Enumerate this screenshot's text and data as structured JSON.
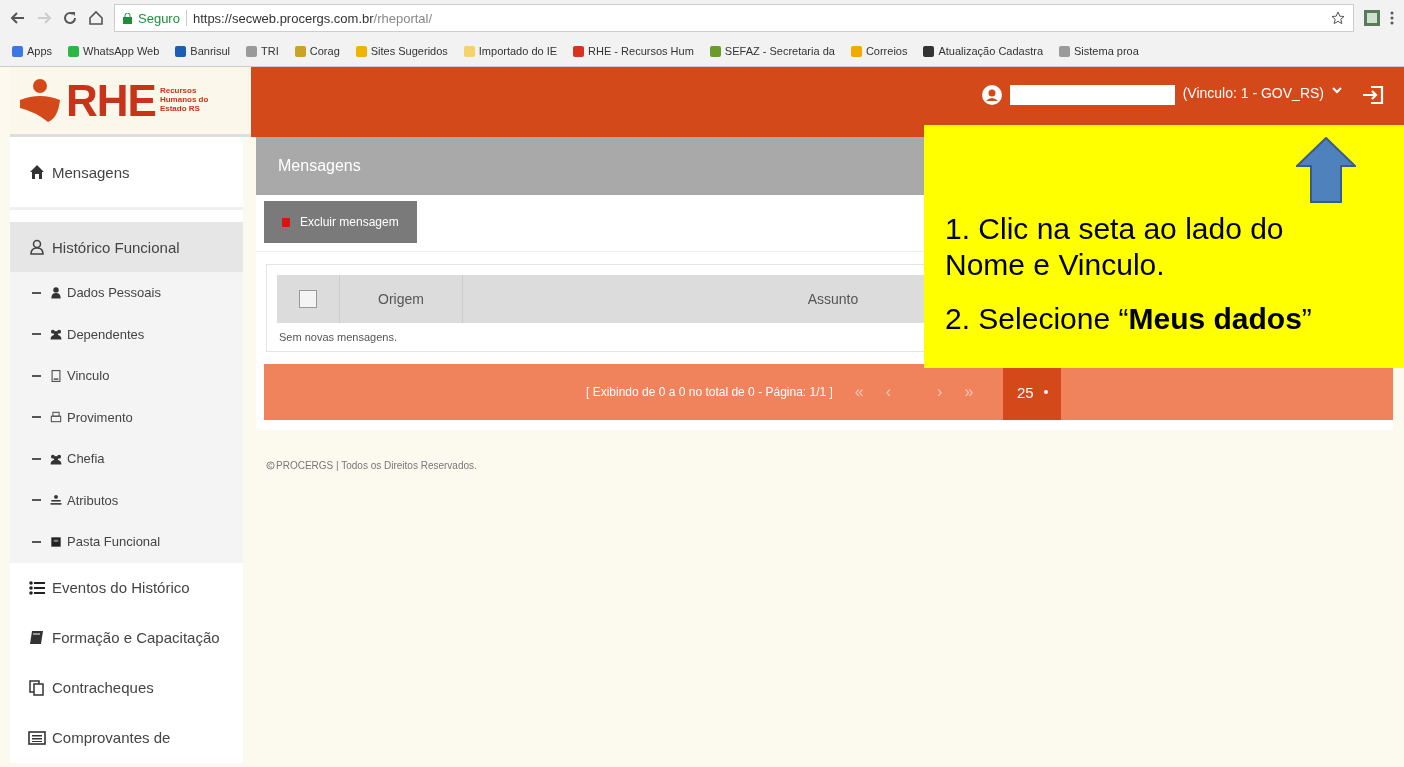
{
  "browser": {
    "secure_label": "Seguro",
    "url_host": "https://secweb.procergs.com.br",
    "url_path": "/rheportal/",
    "bookmarks": [
      {
        "label": "Apps",
        "color": "#3b78e7"
      },
      {
        "label": "WhatsApp Web",
        "color": "#2bb741"
      },
      {
        "label": "Banrisul",
        "color": "#1a5fb4"
      },
      {
        "label": "TRI",
        "color": "#9a9a9a"
      },
      {
        "label": "Corag",
        "color": "#c9a227"
      },
      {
        "label": "Sites Sugeridos",
        "color": "#f0b400"
      },
      {
        "label": "Importado do IE",
        "color": "#f5d36b"
      },
      {
        "label": "RHE - Recursos Hum",
        "color": "#d9321f"
      },
      {
        "label": "SEFAZ - Secretaria da",
        "color": "#6a9a2a"
      },
      {
        "label": "Correios",
        "color": "#f2a900"
      },
      {
        "label": "Atualização Cadastra",
        "color": "#333333"
      },
      {
        "label": "Sistema proa",
        "color": "#9a9a9a"
      }
    ]
  },
  "header": {
    "logo_text": "RHE",
    "logo_subtitle": "Recursos Humanos do Estado RS",
    "user_link": "(Vinculo: 1 - GOV_RS)"
  },
  "sidebar": {
    "items": [
      {
        "label": "Mensagens",
        "selected": false
      },
      {
        "label": "Histórico Funcional",
        "selected": true,
        "children": [
          {
            "label": "Dados Pessoais"
          },
          {
            "label": "Dependentes"
          },
          {
            "label": "Vinculo"
          },
          {
            "label": "Provimento"
          },
          {
            "label": "Chefia"
          },
          {
            "label": "Atributos"
          },
          {
            "label": "Pasta Funcional"
          }
        ]
      },
      {
        "label": "Eventos do Histórico",
        "selected": false
      },
      {
        "label": "Formação e Capacitação",
        "selected": false
      },
      {
        "label": "Contracheques",
        "selected": false
      },
      {
        "label": "Comprovantes de",
        "selected": false
      }
    ]
  },
  "panel": {
    "title": "Mensagens",
    "delete_button": "Excluir mensagem",
    "table": {
      "select_all_checked": false,
      "columns": [
        "Origem",
        "Assunto"
      ],
      "empty_text": "Sem novas mensagens."
    },
    "pager": {
      "summary": "[ Exibindo de 0 a 0 no total de 0 - Página: 1/1 ]",
      "first": "«",
      "prev": "‹",
      "next": "›",
      "last": "»",
      "page_size": "25"
    }
  },
  "footer": "PROCERGS | Todos os Direitos Reservados.",
  "callout": {
    "steps": [
      "1. Clic na seta ao lado do Nome e Vinculo.",
      "2. Selecione “**Meus dados**”"
    ]
  }
}
